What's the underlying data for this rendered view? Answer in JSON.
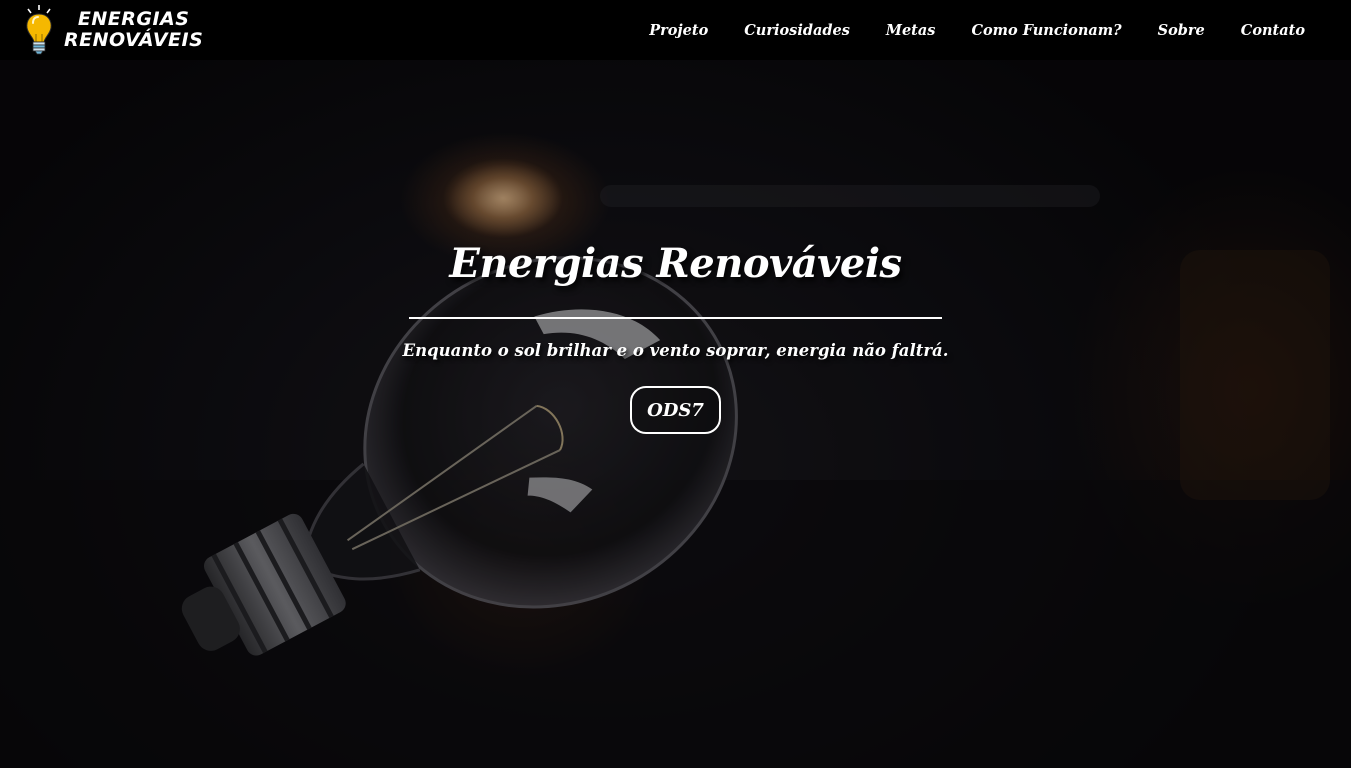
{
  "brand": {
    "line1": "ENERGIAS",
    "line2": "RENOVÁVEIS",
    "icon": "lightbulb-icon",
    "accent_color": "#f5b800"
  },
  "nav": {
    "items": [
      {
        "label": "Projeto"
      },
      {
        "label": "Curiosidades"
      },
      {
        "label": "Metas"
      },
      {
        "label": "Como Funcionam?"
      },
      {
        "label": "Sobre"
      },
      {
        "label": "Contato"
      }
    ]
  },
  "hero": {
    "title": "Energias Renováveis",
    "subtitle": "Enquanto o sol brilhar e o vento soprar, energia não faltrá.",
    "button_label": "ODS7",
    "background": "photo of a light bulb lying on a dark table"
  },
  "colors": {
    "navbar": "#000000",
    "text": "#ffffff"
  }
}
